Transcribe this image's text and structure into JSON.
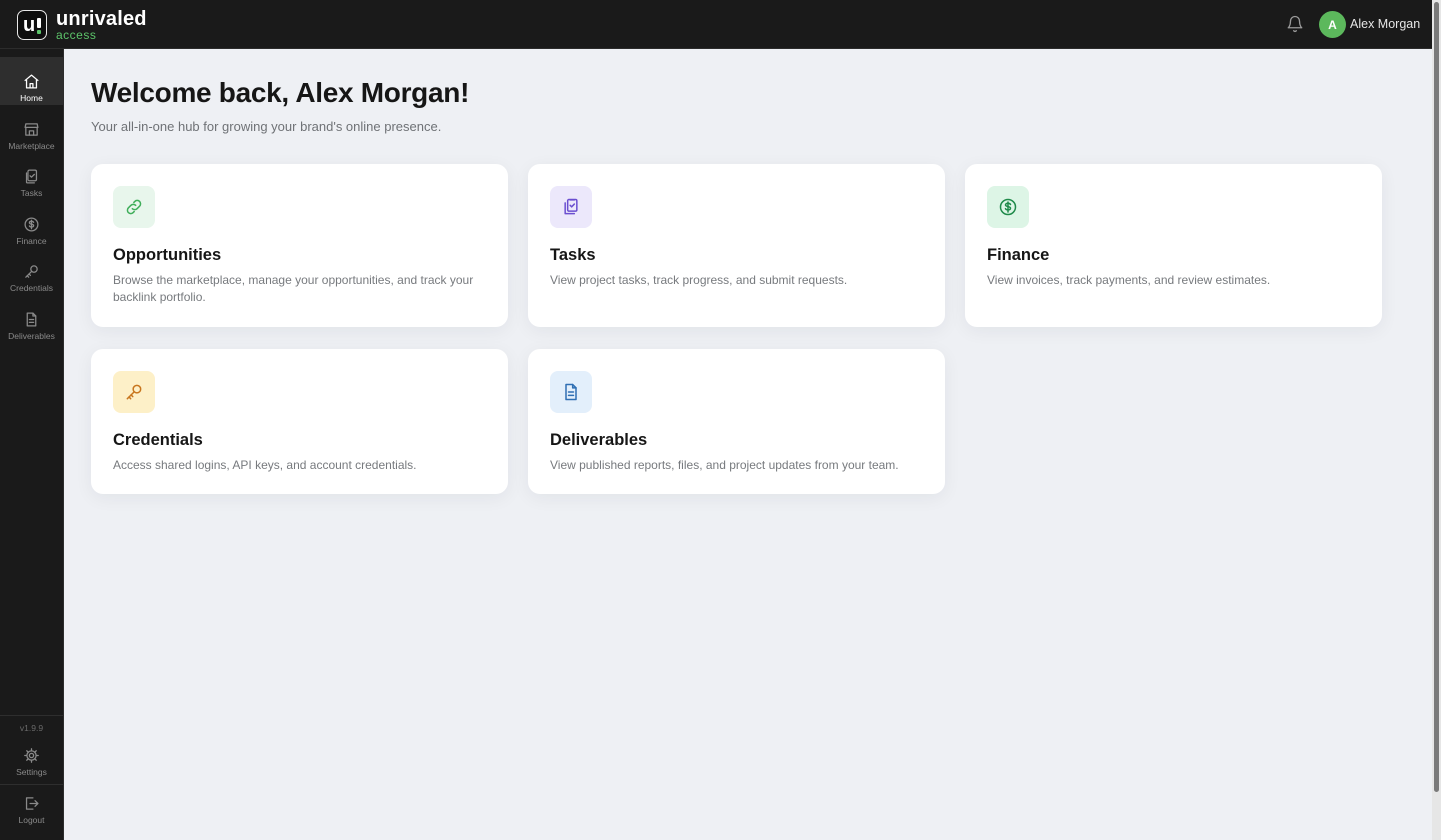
{
  "brand": {
    "name": "unrivaled",
    "sub": "access",
    "accent": "#5cc46a"
  },
  "header": {
    "user_name": "Alex Morgan",
    "avatar_initial": "A",
    "notification_icon": "bell-icon"
  },
  "sidebar": {
    "items": [
      {
        "label": "Home",
        "icon": "home-icon",
        "active": true
      },
      {
        "label": "Marketplace",
        "icon": "store-icon"
      },
      {
        "label": "Tasks",
        "icon": "clipboard-icon"
      },
      {
        "label": "Finance",
        "icon": "dollar-circle-icon"
      },
      {
        "label": "Credentials",
        "icon": "key-icon"
      },
      {
        "label": "Deliverables",
        "icon": "document-icon"
      }
    ],
    "version": "v1.9.9",
    "bottom_items": [
      {
        "label": "Settings",
        "icon": "gear-icon"
      },
      {
        "label": "Logout",
        "icon": "logout-icon"
      }
    ]
  },
  "main": {
    "title": "Welcome back, Alex Morgan!",
    "subtitle": "Your all-in-one hub for growing your brand's online presence.",
    "cards": [
      {
        "title": "Opportunities",
        "description": "Browse the marketplace, manage your opportunities, and track your backlink portfolio.",
        "icon": "link-icon",
        "icon_bg": "#e8f6ec",
        "icon_color": "#3fae5a"
      },
      {
        "title": "Tasks",
        "description": "View project tasks, track progress, and submit requests.",
        "icon": "clipboard-check-icon",
        "icon_bg": "#ece8fb",
        "icon_color": "#6b4fd0"
      },
      {
        "title": "Finance",
        "description": "View invoices, track payments, and review estimates.",
        "icon": "dollar-circle-icon",
        "icon_bg": "#ddf5e6",
        "icon_color": "#1f8a4a"
      },
      {
        "title": "Credentials",
        "description": "Access shared logins, API keys, and account credentials.",
        "icon": "key-icon",
        "icon_bg": "#fdf0c8",
        "icon_color": "#c8761e"
      },
      {
        "title": "Deliverables",
        "description": "View published reports, files, and project updates from your team.",
        "icon": "document-icon",
        "icon_bg": "#e3effb",
        "icon_color": "#2f6fb3"
      }
    ]
  }
}
